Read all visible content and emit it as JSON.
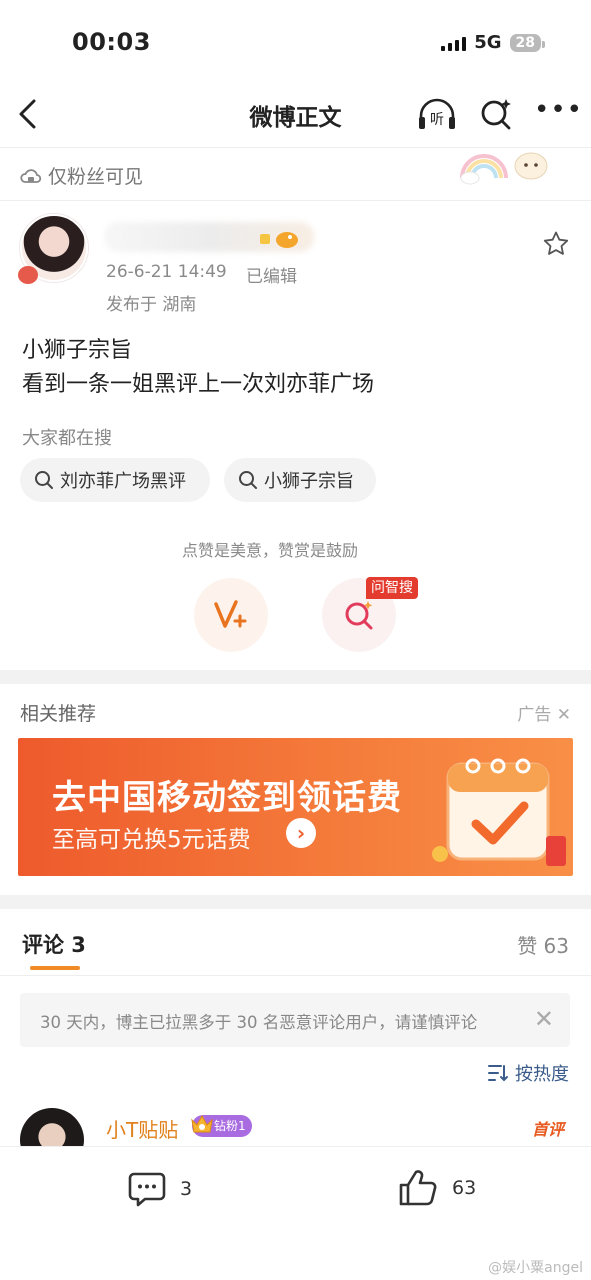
{
  "status_bar": {
    "time": "00:03",
    "network": "5G",
    "battery": "28"
  },
  "nav": {
    "title": "微博正文",
    "listen_icon_text": "听"
  },
  "visibility": {
    "label": "仅粉丝可见"
  },
  "post": {
    "time": "26-6-21 14:49",
    "edited": "已编辑",
    "location": "发布于 湖南",
    "lines": [
      "小狮子宗旨",
      "看到一条一姐黑评上一次刘亦菲广场"
    ]
  },
  "trending": {
    "title": "大家都在搜",
    "chips": [
      "刘亦菲广场黑评",
      "小狮子宗旨"
    ]
  },
  "reward": {
    "hint": "点赞是美意，赞赏是鼓励",
    "ask_tag": "问智搜"
  },
  "related": {
    "title": "相关推荐",
    "ad_label": "广告"
  },
  "ad": {
    "line1": "去中国移动签到领话费",
    "line2": "至高可兑换5元话费"
  },
  "comments": {
    "tab_label": "评论 3",
    "likes_label": "赞 63",
    "notice": "30 天内，博主已拉黑多于 30 名恶意评论用户，请谨慎评论",
    "sort_label": "按热度",
    "first": {
      "name": "小T贴贴",
      "badge": "钻粉1",
      "tag": "首评"
    }
  },
  "bottom_bar": {
    "comment_count": "3",
    "like_count": "63"
  },
  "watermark": "@娱小粟angel",
  "colors": {
    "accent": "#f08a24",
    "ad_orange": "#ee5a2c",
    "link_blue": "#3b5c8a"
  }
}
